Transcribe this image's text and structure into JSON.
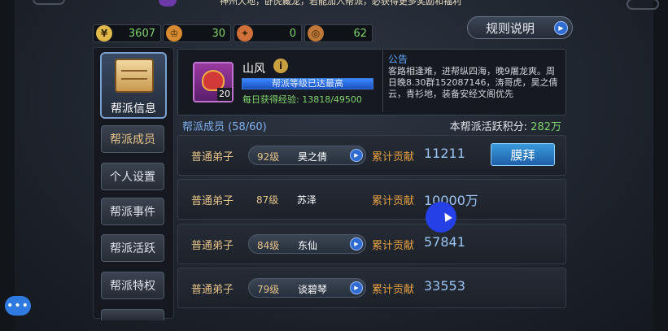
{
  "header": {
    "banner_text": "神州大地，卧虎藏龙，若能加入帮派，必获得更多奖励和福利"
  },
  "currencies": [
    {
      "icon": "gold-coin-icon",
      "value": "3607"
    },
    {
      "icon": "crown-icon",
      "value": "30"
    },
    {
      "icon": "emblem-icon",
      "value": "0"
    },
    {
      "icon": "token-icon",
      "value": "62"
    }
  ],
  "rules_button": {
    "label": "规则说明"
  },
  "menu": {
    "main_label": "帮派信息",
    "items": [
      "帮派成员",
      "个人设置",
      "帮派事件",
      "帮派活跃",
      "帮派特权"
    ]
  },
  "guild": {
    "name": "山风",
    "avatar_level": "20",
    "level_text": "帮派等级已达最高",
    "level_progress": 1.0,
    "exp_text": "每日获得经验: 13818/49500"
  },
  "notice": {
    "title": "公告",
    "text": "客路相逢难，进帮纵四海，晚9屠龙爽。周日晚8.30群152087146，涛哥虎，昊之倩云，青衫地，装备安经文阁优先"
  },
  "members_header": {
    "count_label": "帮派成员 (58/60)",
    "activity_label": "本帮派活跃积分:",
    "activity_value": "282万"
  },
  "members": [
    {
      "rank": "普通弟子",
      "level": "92级",
      "name": "昊之倩",
      "contrib_label": "累计贡献",
      "contrib": "11211",
      "has_pill": true,
      "worship": "膜拜"
    },
    {
      "rank": "普通弟子",
      "level": "87级",
      "name": "苏泽",
      "contrib_label": "累计贡献",
      "contrib": "10000万",
      "has_pill": false
    },
    {
      "rank": "普通弟子",
      "level": "84级",
      "name": "东仙",
      "contrib_label": "累计贡献",
      "contrib": "57841",
      "has_pill": true
    },
    {
      "rank": "普通弟子",
      "level": "79级",
      "name": "谈碧琴",
      "contrib_label": "累计贡献",
      "contrib": "33553",
      "has_pill": true
    }
  ],
  "chat": {
    "icon": "chat-bubble-icon",
    "label": "•••"
  }
}
